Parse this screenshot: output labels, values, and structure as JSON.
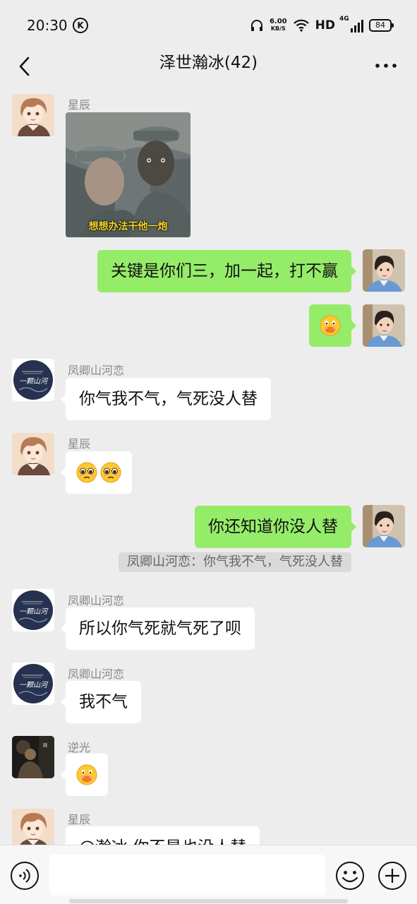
{
  "status_bar": {
    "time": "20:30",
    "k_badge": "K",
    "speed_value": "6.00",
    "speed_unit": "KB/S",
    "hd": "HD",
    "network": "4G",
    "battery": "84"
  },
  "header": {
    "title": "泽世瀚冰(42)"
  },
  "messages": [
    {
      "side": "left",
      "sender": "星辰",
      "type": "image",
      "caption": "想想办法干他一炮"
    },
    {
      "side": "right",
      "type": "text",
      "text": "关键是你们三，加一起，打不赢"
    },
    {
      "side": "right",
      "type": "emoji",
      "emojis": [
        "mouth-covered-emoji"
      ]
    },
    {
      "side": "left",
      "sender": "凤卿山河恋",
      "type": "text",
      "text": "你气我不气，气死没人替"
    },
    {
      "side": "left",
      "sender": "星辰",
      "type": "emoji",
      "emojis": [
        "pleading-emoji",
        "pleading-emoji"
      ]
    },
    {
      "side": "right",
      "type": "text",
      "text": "你还知道你没人替",
      "quote": "凤卿山河恋：你气我不气，气死没人替"
    },
    {
      "side": "left",
      "sender": "凤卿山河恋",
      "type": "text",
      "text": "所以你气死就气死了呗"
    },
    {
      "side": "left",
      "sender": "凤卿山河恋",
      "type": "text",
      "text": "我不气"
    },
    {
      "side": "left",
      "sender": "逆光",
      "type": "emoji",
      "emojis": [
        "mouth-covered-emoji"
      ]
    },
    {
      "side": "left",
      "sender": "星辰",
      "type": "text",
      "text": "@瀚冰 你不是也没人替"
    }
  ],
  "avatar_logo_text": "一颗山河",
  "input": {
    "placeholder": ""
  },
  "colors": {
    "background": "#ededed",
    "bubble_out": "#95ec69",
    "bubble_in": "#ffffff",
    "sender_name": "#888888"
  }
}
